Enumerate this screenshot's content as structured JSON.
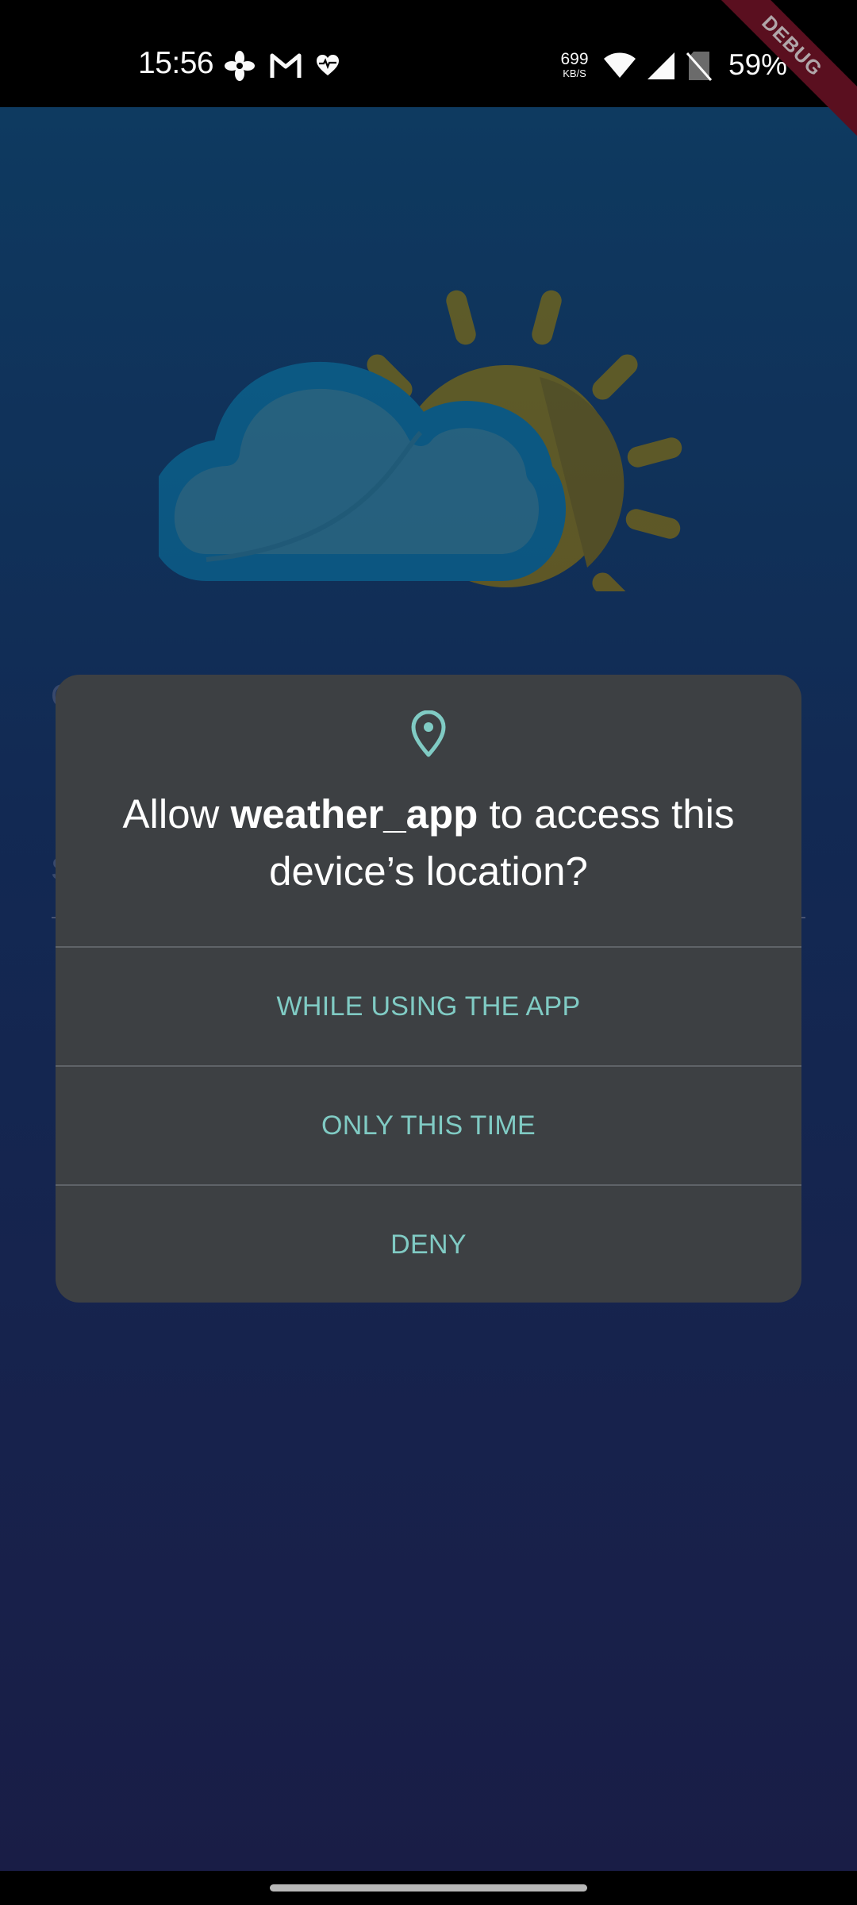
{
  "status_bar": {
    "time": "15:56",
    "network_speed_value": "699",
    "network_speed_unit": "KB/S",
    "battery": "59%",
    "notification_icons": [
      "fan-icon",
      "gmail-icon",
      "heart-pulse-icon"
    ],
    "system_icons": [
      "wifi-icon",
      "signal-icon",
      "no-sim-icon"
    ]
  },
  "debug_banner": "DEBUG",
  "dialog": {
    "title_prefix": "Allow ",
    "app_name": "weather_app",
    "title_suffix": " to access this device’s location?",
    "icon": "location-pin-icon",
    "options": {
      "while_using": "WHILE USING THE APP",
      "only_this_time": "ONLY THIS TIME",
      "deny": "DENY"
    }
  },
  "background": {
    "illustration": "cloud-sun-icon",
    "field_letter_1": "C",
    "field_letter_2": "S"
  },
  "colors": {
    "dialog_background": "#3d4043",
    "accent": "#80cbc4",
    "app_gradient_top": "#0f3c62",
    "app_gradient_bottom": "#1a1e48",
    "sun": "#7a6200",
    "cloud_outline": "#0a5675"
  }
}
